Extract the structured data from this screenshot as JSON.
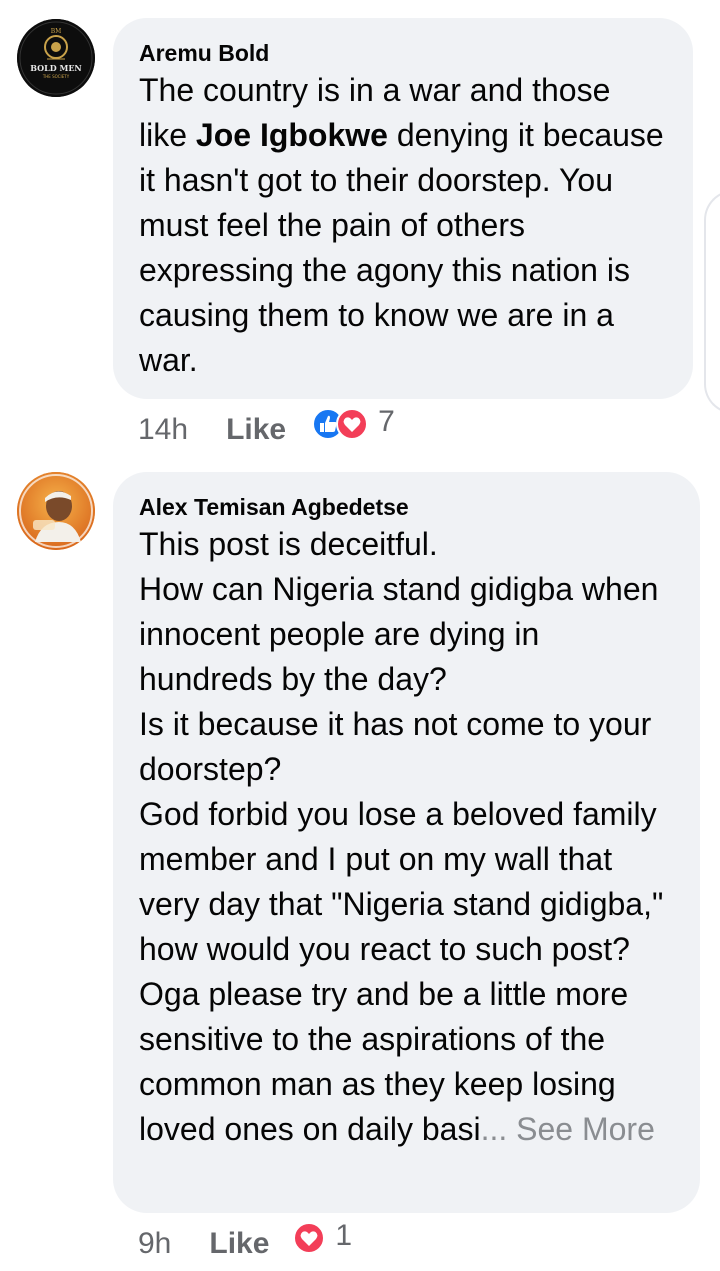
{
  "comments": [
    {
      "author": "Aremu Bold",
      "avatar_text_top": "BM",
      "avatar_text_main": "BOLD MEN",
      "avatar_text_sub": "THE SOCIETY",
      "text_before": "The country is in a war and those like ",
      "mention": "Joe Igbokwe",
      "text_after": " denying it because it hasn't got to their doorstep. You must feel the pain of others expressing the agony this nation is causing them to know we are in a war.",
      "time": "14h",
      "like_label": "Like",
      "reaction_count": "7",
      "reactions": [
        "like-icon",
        "love-icon"
      ]
    },
    {
      "author": "Alex Temisan Agbedetse",
      "lines": [
        "This post is deceitful.",
        "How can Nigeria stand gidigba when innocent people are dying in hundreds by the day?",
        "Is it because it has not come to your doorstep?",
        "God forbid you lose a beloved family member and I put on my wall that very day that \"Nigeria stand gidigba,\" how would you react to such post?",
        "Oga please try and be a little more sensitive to the aspirations of the common man as they keep losing loved ones on daily basi"
      ],
      "see_more": "... See More",
      "time": "9h",
      "like_label": "Like",
      "reaction_count": "1",
      "reactions": [
        "love-icon"
      ]
    }
  ],
  "colors": {
    "bubble": "#f0f2f5",
    "meta": "#65676b",
    "like_blue": "#1877f2",
    "love_red": "#f33e58"
  }
}
